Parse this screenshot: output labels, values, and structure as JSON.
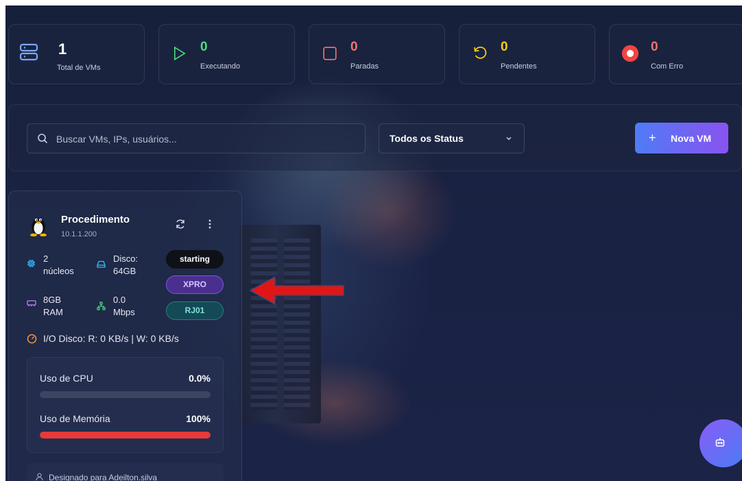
{
  "stats": [
    {
      "value": "1",
      "label": "Total de VMs",
      "icon": "server-icon",
      "color": "#7aa8ff"
    },
    {
      "value": "0",
      "label": "Executando",
      "icon": "play-icon",
      "color": "#4ade80"
    },
    {
      "value": "0",
      "label": "Paradas",
      "icon": "stop-icon",
      "color": "#f87171"
    },
    {
      "value": "0",
      "label": "Pendentes",
      "icon": "rotate-ccw-icon",
      "color": "#facc15"
    },
    {
      "value": "0",
      "label": "Com Erro",
      "icon": "error-record-icon",
      "color": "#ef4444"
    }
  ],
  "toolbar": {
    "search_placeholder": "Buscar VMs, IPs, usuários...",
    "status_filter": "Todos os Status",
    "new_vm_label": "Nova VM"
  },
  "vm": {
    "name": "Procedimento",
    "ip": "10.1.1.200",
    "os_icon": "linux-tux-icon",
    "cores_value": "2",
    "cores_label": "núcleos",
    "disk_label": "Disco:",
    "disk_value": "64GB",
    "ram_value": "8GB",
    "ram_label": "RAM",
    "net_value": "0.0",
    "net_label": "Mbps",
    "status": "starting",
    "tag1": "XPRO",
    "tag2": "RJ01",
    "io": "I/O Disco: R: 0 KB/s | W: 0 KB/s",
    "cpu_label": "Uso de CPU",
    "cpu_value": "0.0%",
    "cpu_fraction": 0.0,
    "mem_label": "Uso de Memória",
    "mem_value": "100%",
    "mem_fraction": 1.0,
    "assigned": "Designado para Adeilton.silva"
  },
  "colors": {
    "accent_gradient_start": "#4f7cf6",
    "accent_gradient_end": "#8a52f0",
    "memory_bar": "#e53a3a",
    "annotation_arrow": "#e01616"
  }
}
